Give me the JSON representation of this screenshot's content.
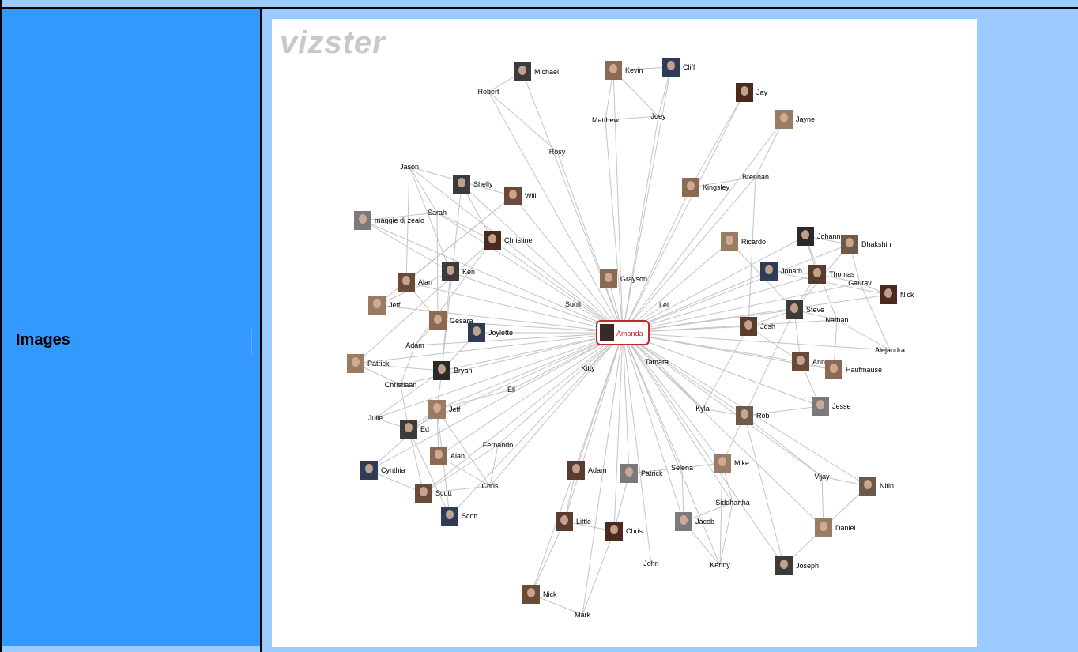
{
  "sidebar": {
    "label": "Images"
  },
  "graph": {
    "logo": "vizster",
    "focus": "Amanda",
    "nodes": [
      {
        "id": "michael",
        "label": "Michael",
        "photo": true
      },
      {
        "id": "robert",
        "label": "Robert",
        "photo": false
      },
      {
        "id": "kevin",
        "label": "Kevin",
        "photo": true
      },
      {
        "id": "cliff",
        "label": "Cliff",
        "photo": true
      },
      {
        "id": "matthew",
        "label": "Matthew",
        "photo": false
      },
      {
        "id": "joey",
        "label": "Joey",
        "photo": false
      },
      {
        "id": "jay",
        "label": "Jay",
        "photo": true
      },
      {
        "id": "jayne",
        "label": "Jayne",
        "photo": true
      },
      {
        "id": "rosy",
        "label": "Rosy",
        "photo": false
      },
      {
        "id": "jason",
        "label": "Jason",
        "photo": false
      },
      {
        "id": "shelly",
        "label": "Shelly",
        "photo": true
      },
      {
        "id": "will",
        "label": "Will",
        "photo": true
      },
      {
        "id": "kingsley",
        "label": "Kingsley",
        "photo": true
      },
      {
        "id": "brennan",
        "label": "Brennan",
        "photo": false
      },
      {
        "id": "sarah",
        "label": "Sarah",
        "photo": false
      },
      {
        "id": "maggie",
        "label": "maggie dj zealo",
        "photo": true
      },
      {
        "id": "christine",
        "label": "Christine",
        "photo": true
      },
      {
        "id": "ricardo",
        "label": "Ricardo",
        "photo": true
      },
      {
        "id": "johanna",
        "label": "Johanna",
        "photo": true
      },
      {
        "id": "dhakshin",
        "label": "Dhakshin",
        "photo": true
      },
      {
        "id": "ken",
        "label": "Ken",
        "photo": true
      },
      {
        "id": "alan1",
        "label": "Alan",
        "photo": true
      },
      {
        "id": "grayson",
        "label": "Grayson",
        "photo": true
      },
      {
        "id": "jonath",
        "label": "Jonath",
        "photo": true
      },
      {
        "id": "thomas",
        "label": "Thomas",
        "photo": true
      },
      {
        "id": "gaurav",
        "label": "Gaurav",
        "photo": false
      },
      {
        "id": "nick1",
        "label": "Nick",
        "photo": true
      },
      {
        "id": "jeff1",
        "label": "Jeff",
        "photo": true
      },
      {
        "id": "sunil",
        "label": "Sunil",
        "photo": false
      },
      {
        "id": "lei",
        "label": "Lei",
        "photo": false
      },
      {
        "id": "steve",
        "label": "Steve",
        "photo": true
      },
      {
        "id": "nathan",
        "label": "Nathan",
        "photo": false
      },
      {
        "id": "gesara",
        "label": "Gesara",
        "photo": true
      },
      {
        "id": "joylette",
        "label": "Joylette",
        "photo": true
      },
      {
        "id": "josh",
        "label": "Josh",
        "photo": true
      },
      {
        "id": "adam1",
        "label": "Adam",
        "photo": false
      },
      {
        "id": "alejandra",
        "label": "Alejandra",
        "photo": false
      },
      {
        "id": "patrick1",
        "label": "Patrick",
        "photo": true
      },
      {
        "id": "bryan",
        "label": "Bryan",
        "photo": true
      },
      {
        "id": "kitty",
        "label": "Kitty",
        "photo": false
      },
      {
        "id": "tamara",
        "label": "Tamara",
        "photo": false
      },
      {
        "id": "ann",
        "label": "Ann",
        "photo": true
      },
      {
        "id": "haufmause",
        "label": "Haufmause",
        "photo": true
      },
      {
        "id": "christiaan",
        "label": "Christiaan",
        "photo": false
      },
      {
        "id": "eli",
        "label": "Eli",
        "photo": false
      },
      {
        "id": "jesse",
        "label": "Jesse",
        "photo": true
      },
      {
        "id": "julie",
        "label": "Julie",
        "photo": false
      },
      {
        "id": "jeff2",
        "label": "Jeff",
        "photo": true
      },
      {
        "id": "kyla",
        "label": "Kyla",
        "photo": false
      },
      {
        "id": "rob",
        "label": "Rob",
        "photo": true
      },
      {
        "id": "ed",
        "label": "Ed",
        "photo": true
      },
      {
        "id": "fernando",
        "label": "Fernando",
        "photo": false
      },
      {
        "id": "alan2",
        "label": "Alan",
        "photo": true
      },
      {
        "id": "cynthia",
        "label": "Cynthia",
        "photo": true
      },
      {
        "id": "adam2",
        "label": "Adam",
        "photo": true
      },
      {
        "id": "patrick2",
        "label": "Patrick",
        "photo": true
      },
      {
        "id": "selena",
        "label": "Selena",
        "photo": false
      },
      {
        "id": "mike",
        "label": "Mike",
        "photo": true
      },
      {
        "id": "vijay",
        "label": "Vijay",
        "photo": false
      },
      {
        "id": "nitin",
        "label": "Nitin",
        "photo": true
      },
      {
        "id": "chris1",
        "label": "Chris",
        "photo": false
      },
      {
        "id": "scott1",
        "label": "Scott",
        "photo": true
      },
      {
        "id": "siddhartha",
        "label": "Siddhartha",
        "photo": false
      },
      {
        "id": "scott2",
        "label": "Scott",
        "photo": true
      },
      {
        "id": "little",
        "label": "Little",
        "photo": true
      },
      {
        "id": "jacob",
        "label": "Jacob",
        "photo": true
      },
      {
        "id": "chris2",
        "label": "Chris",
        "photo": true
      },
      {
        "id": "daniel",
        "label": "Daniel",
        "photo": true
      },
      {
        "id": "john",
        "label": "John",
        "photo": false
      },
      {
        "id": "kenny",
        "label": "Kenny",
        "photo": false
      },
      {
        "id": "joseph",
        "label": "Joseph",
        "photo": true
      },
      {
        "id": "nick2",
        "label": "Nick",
        "photo": true
      },
      {
        "id": "mark",
        "label": "Mark",
        "photo": false
      }
    ],
    "edges": [
      [
        "jason",
        "sarah"
      ],
      [
        "jason",
        "will"
      ],
      [
        "jason",
        "alan1"
      ],
      [
        "jason",
        "ken"
      ],
      [
        "sarah",
        "maggie"
      ],
      [
        "sarah",
        "christine"
      ],
      [
        "sarah",
        "gesara"
      ],
      [
        "maggie",
        "ken"
      ],
      [
        "shelly",
        "bryan"
      ],
      [
        "shelly",
        "christine"
      ],
      [
        "will",
        "alan1"
      ],
      [
        "will",
        "jeff1"
      ],
      [
        "christine",
        "adam1"
      ],
      [
        "christine",
        "patrick1"
      ],
      [
        "ken",
        "jeff1"
      ],
      [
        "ken",
        "bryan"
      ],
      [
        "alan1",
        "gesara"
      ],
      [
        "gesara",
        "adam1"
      ],
      [
        "joylette",
        "bryan"
      ],
      [
        "adam1",
        "christiaan"
      ],
      [
        "patrick1",
        "christiaan"
      ],
      [
        "patrick1",
        "bryan"
      ],
      [
        "bryan",
        "julie"
      ],
      [
        "bryan",
        "jeff2"
      ],
      [
        "christiaan",
        "ed"
      ],
      [
        "julie",
        "ed"
      ],
      [
        "jeff2",
        "ed"
      ],
      [
        "jeff2",
        "cynthia"
      ],
      [
        "jeff2",
        "alan2"
      ],
      [
        "jeff2",
        "chris1"
      ],
      [
        "ed",
        "scott1"
      ],
      [
        "ed",
        "scott2"
      ],
      [
        "cynthia",
        "scott1"
      ],
      [
        "alan2",
        "chris1"
      ],
      [
        "scott1",
        "chris1"
      ],
      [
        "fernando",
        "scott1"
      ],
      [
        "fernando",
        "chris1"
      ],
      [
        "eli",
        "jeff2"
      ],
      [
        "scott2",
        "jeff2"
      ],
      [
        "michael",
        "robert"
      ],
      [
        "kevin",
        "cliff"
      ],
      [
        "kevin",
        "matthew"
      ],
      [
        "kevin",
        "joey"
      ],
      [
        "matthew",
        "joey"
      ],
      [
        "cliff",
        "joey"
      ],
      [
        "rosy",
        "robert"
      ],
      [
        "jay",
        "kingsley"
      ],
      [
        "jayne",
        "brennan"
      ],
      [
        "kingsley",
        "brennan"
      ],
      [
        "brennan",
        "josh"
      ],
      [
        "ricardo",
        "steve"
      ],
      [
        "johanna",
        "dhakshin"
      ],
      [
        "johanna",
        "thomas"
      ],
      [
        "johanna",
        "nathan"
      ],
      [
        "dhakshin",
        "gaurav"
      ],
      [
        "dhakshin",
        "steve"
      ],
      [
        "jonath",
        "thomas"
      ],
      [
        "jonath",
        "nick1"
      ],
      [
        "thomas",
        "gaurav"
      ],
      [
        "thomas",
        "steve"
      ],
      [
        "gaurav",
        "nick1"
      ],
      [
        "gaurav",
        "alejandra"
      ],
      [
        "steve",
        "nathan"
      ],
      [
        "steve",
        "josh"
      ],
      [
        "steve",
        "ann"
      ],
      [
        "nathan",
        "alejandra"
      ],
      [
        "nathan",
        "haufmause"
      ],
      [
        "josh",
        "ann"
      ],
      [
        "ann",
        "haufmause"
      ],
      [
        "ann",
        "jesse"
      ],
      [
        "rob",
        "kyla"
      ],
      [
        "rob",
        "jesse"
      ],
      [
        "rob",
        "vijay"
      ],
      [
        "rob",
        "mike"
      ],
      [
        "vijay",
        "nitin"
      ],
      [
        "vijay",
        "daniel"
      ],
      [
        "nitin",
        "daniel"
      ],
      [
        "daniel",
        "joseph"
      ],
      [
        "mike",
        "siddhartha"
      ],
      [
        "mike",
        "selena"
      ],
      [
        "selena",
        "jacob"
      ],
      [
        "siddhartha",
        "kenny"
      ],
      [
        "siddhartha",
        "jacob"
      ],
      [
        "jacob",
        "kenny"
      ],
      [
        "adam2",
        "little"
      ],
      [
        "little",
        "chris2"
      ],
      [
        "little",
        "nick2"
      ],
      [
        "patrick2",
        "chris2"
      ],
      [
        "patrick2",
        "selena"
      ],
      [
        "nick2",
        "mark"
      ],
      [
        "chris2",
        "mark"
      ],
      [
        "kyla",
        "josh"
      ],
      [
        "tamara",
        "kyla"
      ],
      [
        "rob",
        "steve"
      ],
      [
        "kenny",
        "mike"
      ],
      [
        "joseph",
        "rob"
      ]
    ]
  }
}
